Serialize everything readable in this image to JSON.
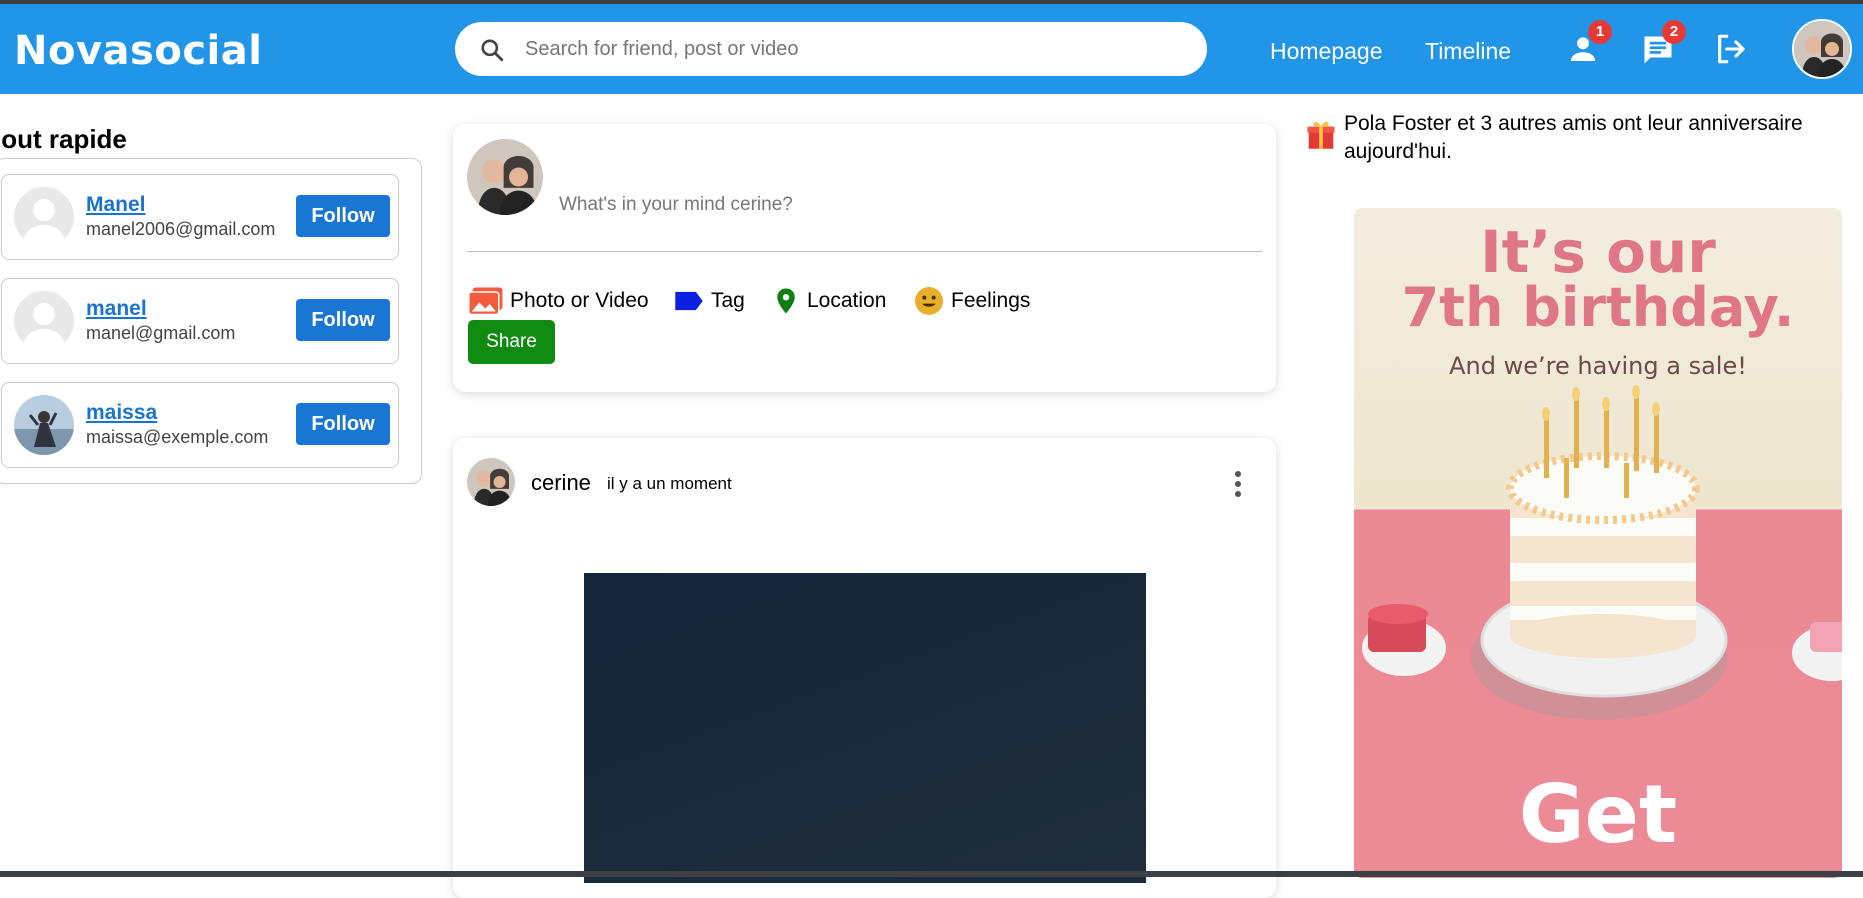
{
  "app": {
    "logo": "Novasocial"
  },
  "colors": {
    "brand": "#2196e8",
    "follow": "#1976d2",
    "share": "#108a10",
    "badge": "#e53935"
  },
  "search": {
    "placeholder": "Search for friend, post or video",
    "icon": "search-icon"
  },
  "nav": {
    "homepage": "Homepage",
    "timeline": "Timeline",
    "friends_badge": "1",
    "messages_badge": "2",
    "icons": [
      "person-icon",
      "chat-icon",
      "logout-icon"
    ]
  },
  "sidebar": {
    "title": "jout rapide",
    "users": [
      {
        "name": "Manel",
        "email": "manel2006@gmail.com",
        "follow": "Follow",
        "avatar": "default-avatar"
      },
      {
        "name": "manel",
        "email": "manel@gmail.com",
        "follow": "Follow",
        "avatar": "default-avatar"
      },
      {
        "name": "maissa",
        "email": "maissa@exemple.com",
        "follow": "Follow",
        "avatar": "photo-avatar"
      }
    ]
  },
  "composer": {
    "placeholder": "What's in your mind cerine?",
    "options": {
      "photo": "Photo or Video",
      "tag": "Tag",
      "location": "Location",
      "feelings": "Feelings"
    },
    "share": "Share"
  },
  "post": {
    "author": "cerine",
    "time": "il y a un moment"
  },
  "birthday": {
    "text": "Pola Foster et 3 autres amis ont leur anniversaire aujourd'hui."
  },
  "ad": {
    "line1": "It’s our",
    "line2": "7th birthday.",
    "line3": "And we’re having a sale!",
    "line4": "Get"
  }
}
